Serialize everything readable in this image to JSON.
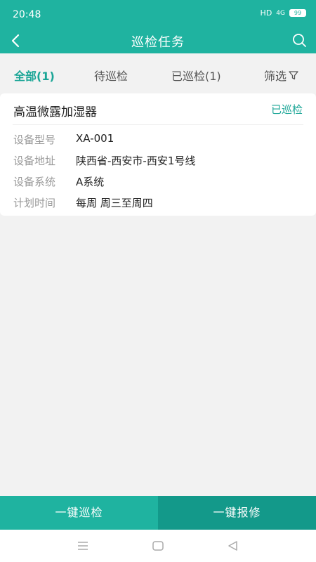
{
  "status_bar": {
    "time": "20:48",
    "hd": "HD",
    "signal": "4G",
    "battery": "99"
  },
  "app_bar": {
    "title": "巡检任务",
    "back_icon": "back-arrow-icon",
    "search_icon": "search-icon"
  },
  "tabs": [
    {
      "label": "全部(1)",
      "active": true
    },
    {
      "label": "待巡检",
      "active": false
    },
    {
      "label": "已巡检(1)",
      "active": false
    }
  ],
  "filter": {
    "label": "筛选",
    "icon": "filter-icon"
  },
  "task": {
    "name": "高温微露加湿器",
    "status": "已巡检",
    "fields": [
      {
        "label": "设备型号",
        "value": "XA-001"
      },
      {
        "label": "设备地址",
        "value": "陕西省-西安市-西安1号线"
      },
      {
        "label": "设备系统",
        "value": "A系统"
      },
      {
        "label": "计划时间",
        "value": "每周 周三至周四"
      }
    ]
  },
  "actions": {
    "inspect_label": "一键巡检",
    "repair_label": "一键报修"
  },
  "colors": {
    "primary": "#1fb3a0",
    "primary_dark": "#13998a",
    "accent_text": "#1aa596"
  },
  "nav_bar": {
    "icons": [
      "menu-icon",
      "home-icon",
      "back-triangle-icon"
    ]
  }
}
